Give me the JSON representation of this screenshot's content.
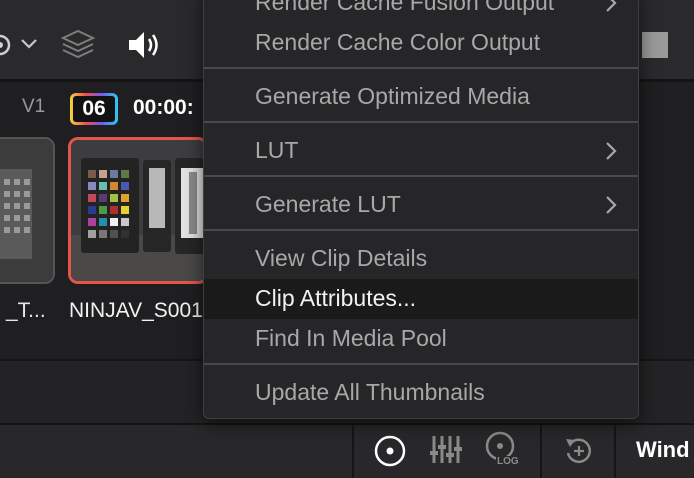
{
  "toolbar": {
    "icons": [
      "mixer-color-icon",
      "chevron-down-icon",
      "layers-icon",
      "speaker-icon",
      "stop-square-icon"
    ]
  },
  "timeline": {
    "track_label": "V1",
    "clip_number": "06",
    "timecode": "00:00:",
    "clips": [
      {
        "name": "_T..."
      },
      {
        "name": "NINJAV_S001"
      }
    ]
  },
  "context_menu": {
    "items": [
      {
        "label": "Render Cache Fusion Output",
        "submenu": true
      },
      {
        "label": "Render Cache Color Output",
        "submenu": false
      },
      {
        "label": "Generate Optimized Media",
        "submenu": false
      },
      {
        "label": "LUT",
        "submenu": true
      },
      {
        "label": "Generate LUT",
        "submenu": true
      },
      {
        "label": "View Clip Details",
        "submenu": false
      },
      {
        "label": "Clip Attributes...",
        "submenu": false,
        "highlighted": true
      },
      {
        "label": "Find In Media Pool",
        "submenu": false
      },
      {
        "label": "Update All Thumbnails",
        "submenu": false
      }
    ]
  },
  "bottom_bar": {
    "log_label": "LOG",
    "window_label": "Wind",
    "icons": [
      "primary-wheels-icon",
      "curves-bars-icon",
      "log-wheel-icon",
      "rotate-add-icon"
    ]
  },
  "colors": {
    "accent_clip_border": "#e5554a",
    "menu_background": "#262628",
    "menu_text": "#a8a8a8",
    "menu_highlight_text": "#f2f2f2"
  }
}
